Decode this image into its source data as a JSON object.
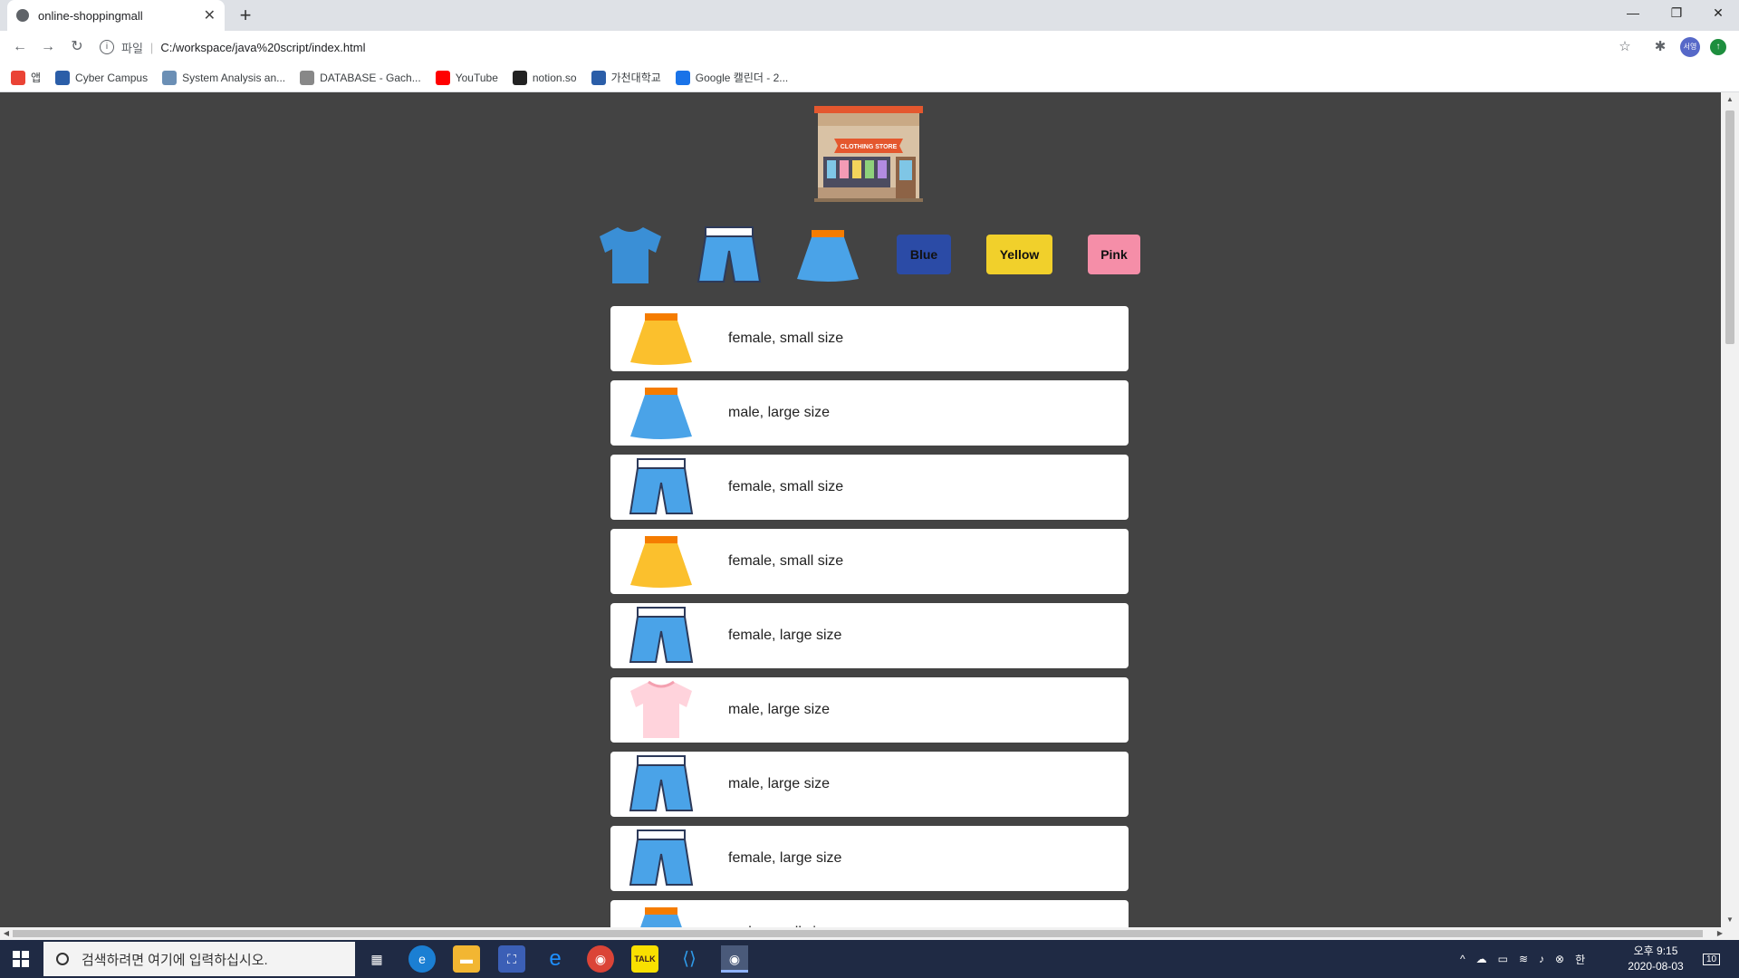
{
  "browser": {
    "tab_title": "online-shoppingmall",
    "tab_close": "✕",
    "new_tab": "+",
    "url_scheme": "파일",
    "url": "C:/workspace/java%20script/index.html",
    "window_controls": [
      "—",
      "❐",
      "✕"
    ]
  },
  "bookmarks": [
    {
      "label": "앱",
      "icon": "apps-icon",
      "color": "#ea4335"
    },
    {
      "label": "Cyber Campus",
      "icon": "g-icon",
      "color": "#2b5ea8"
    },
    {
      "label": "System Analysis an...",
      "icon": "globe-icon",
      "color": "#6b8fb5"
    },
    {
      "label": "DATABASE - Gach...",
      "icon": "doc-icon",
      "color": "#888888"
    },
    {
      "label": "YouTube",
      "icon": "youtube-icon",
      "color": "#ff0000"
    },
    {
      "label": "notion.so",
      "icon": "notion-icon",
      "color": "#222222"
    },
    {
      "label": "가천대학교",
      "icon": "g-icon",
      "color": "#2b5ea8"
    },
    {
      "label": "Google 캘린더 - 2...",
      "icon": "calendar-icon",
      "color": "#1a73e8"
    }
  ],
  "filters": {
    "color_buttons": [
      {
        "label": "Blue",
        "bg": "#2b4ba6",
        "fg": "#111111"
      },
      {
        "label": "Yellow",
        "bg": "#f1d02b",
        "fg": "#111111"
      },
      {
        "label": "Pink",
        "bg": "#f58ea8",
        "fg": "#111111"
      }
    ]
  },
  "items": [
    {
      "type": "skirt",
      "color": "yellow",
      "desc": "female, small size"
    },
    {
      "type": "skirt",
      "color": "blue",
      "desc": "male, large size"
    },
    {
      "type": "pants",
      "color": "blue",
      "desc": "female, small size"
    },
    {
      "type": "skirt",
      "color": "yellow",
      "desc": "female, small size"
    },
    {
      "type": "pants",
      "color": "blue",
      "desc": "female, large size"
    },
    {
      "type": "tshirt",
      "color": "pink",
      "desc": "male, large size"
    },
    {
      "type": "pants",
      "color": "blue",
      "desc": "male, large size"
    },
    {
      "type": "pants",
      "color": "blue",
      "desc": "female, large size"
    },
    {
      "type": "skirt",
      "color": "blue",
      "desc": "male, small size"
    }
  ],
  "palette": {
    "yellow": "#fbc02d",
    "blue": "#4aa3e8",
    "pink": "#ffd3dc",
    "tshirt_blue": "#3a8fd6"
  },
  "taskbar": {
    "search_placeholder": "검색하려면 여기에 입력하십시오.",
    "time": "오후 9:15",
    "date": "2020-08-03",
    "notifications": "10"
  }
}
